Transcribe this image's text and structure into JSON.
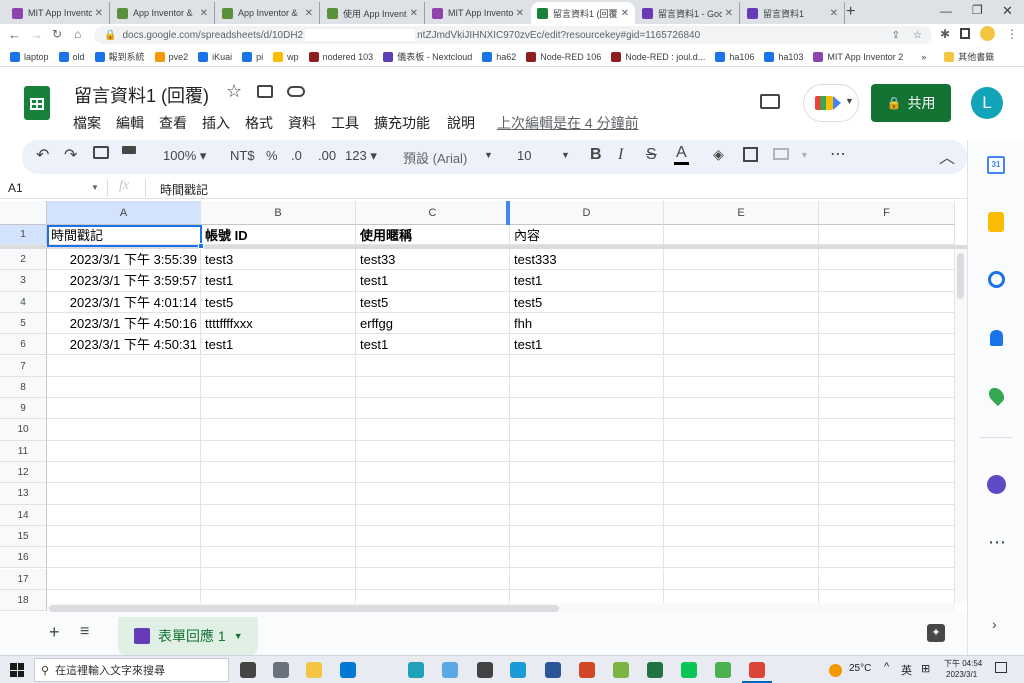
{
  "browser": {
    "tabs": [
      {
        "label": "MIT App Invento",
        "color": "#8e44ad"
      },
      {
        "label": "App Inventor &",
        "color": "#5a8f3c"
      },
      {
        "label": "App Inventor &",
        "color": "#5a8f3c"
      },
      {
        "label": "使用 App Invent",
        "color": "#5a8f3c"
      },
      {
        "label": "MIT App Invento",
        "color": "#8e44ad"
      },
      {
        "label": "留言資料1 (回覆",
        "color": "#188038"
      },
      {
        "label": "留言資料1 - Goo",
        "color": "#673ab7"
      },
      {
        "label": "留言資料1",
        "color": "#673ab7"
      }
    ],
    "url_left": "docs.google.com/spreadsheets/d/10DH2",
    "url_right": "ntZJmdVkiJIHNXIC970zvEc/edit?resourcekey#gid=1165726840",
    "bookmarks": [
      "laptop",
      "old",
      "報到系統",
      "pve2",
      "iKuai",
      "pi",
      "wp",
      "nodered 103",
      "儀表板 - Nextcloud",
      "ha62",
      "Node-RED 106",
      "Node-RED : joul.d...",
      "ha106",
      "ha103",
      "MIT App Inventor 2"
    ],
    "bookmarks_more": "»",
    "other_bookmarks": "其他書籤"
  },
  "sheets": {
    "doc_title": "留言資料1 (回覆)",
    "menu": [
      "檔案",
      "編輯",
      "查看",
      "插入",
      "格式",
      "資料",
      "工具",
      "擴充功能",
      "說明"
    ],
    "last_edit": "上次編輯是在 4 分鐘前",
    "share_label": "共用",
    "avatar_letter": "L",
    "toolbar": {
      "zoom": "100%",
      "currency": "NT$",
      "percent": "%",
      "dec_decrease": ".0",
      "dec_increase": ".00",
      "more_formats": "123",
      "font": "預設 (Arial)",
      "font_size": "10"
    },
    "name_box": "A1",
    "fx": "fx",
    "formula": "時間戳記",
    "columns": [
      "A",
      "B",
      "C",
      "D",
      "E",
      "F"
    ],
    "rows": [
      [
        "時間戳記",
        "帳號 ID",
        "使用暱稱",
        "內容",
        "",
        ""
      ],
      [
        "2023/3/1 下午 3:55:39",
        "test3",
        "test33",
        "test333",
        "",
        ""
      ],
      [
        "2023/3/1 下午 3:59:57",
        "test1",
        "test1",
        "test1",
        "",
        ""
      ],
      [
        "2023/3/1 下午 4:01:14",
        "test5",
        "test5",
        "test5",
        "",
        ""
      ],
      [
        "2023/3/1 下午 4:50:16",
        "ttttffffxxx",
        "erffgg",
        "fhh",
        "",
        ""
      ],
      [
        "2023/3/1 下午 4:50:31",
        "test1",
        "test1",
        "test1",
        "",
        ""
      ],
      [
        "",
        "",
        "",
        "",
        "",
        ""
      ],
      [
        "",
        "",
        "",
        "",
        "",
        ""
      ],
      [
        "",
        "",
        "",
        "",
        "",
        ""
      ],
      [
        "",
        "",
        "",
        "",
        "",
        ""
      ],
      [
        "",
        "",
        "",
        "",
        "",
        ""
      ],
      [
        "",
        "",
        "",
        "",
        "",
        ""
      ],
      [
        "",
        "",
        "",
        "",
        "",
        ""
      ],
      [
        "",
        "",
        "",
        "",
        "",
        ""
      ],
      [
        "",
        "",
        "",
        "",
        "",
        ""
      ],
      [
        "",
        "",
        "",
        "",
        "",
        ""
      ],
      [
        "",
        "",
        "",
        "",
        "",
        ""
      ],
      [
        "",
        "",
        "",
        "",
        "",
        ""
      ]
    ],
    "row_numbers": [
      "1",
      "2",
      "3",
      "4",
      "5",
      "6",
      "7",
      "8",
      "9",
      "10",
      "11",
      "12",
      "13",
      "14",
      "15",
      "16",
      "17",
      "18"
    ],
    "sheet_tab": "表單回應 1"
  },
  "side_panel": {
    "calendar_day": "31"
  },
  "taskbar": {
    "search_placeholder": "在這裡輸入文字來搜尋",
    "weather": "25°C",
    "ime": "英",
    "time": "下午 04:54",
    "date": "2023/3/1"
  },
  "colors": {
    "sheets_green": "#188038",
    "share_green": "#137333",
    "selection_blue": "#1a73e8",
    "avatar": "#12a4b8"
  }
}
